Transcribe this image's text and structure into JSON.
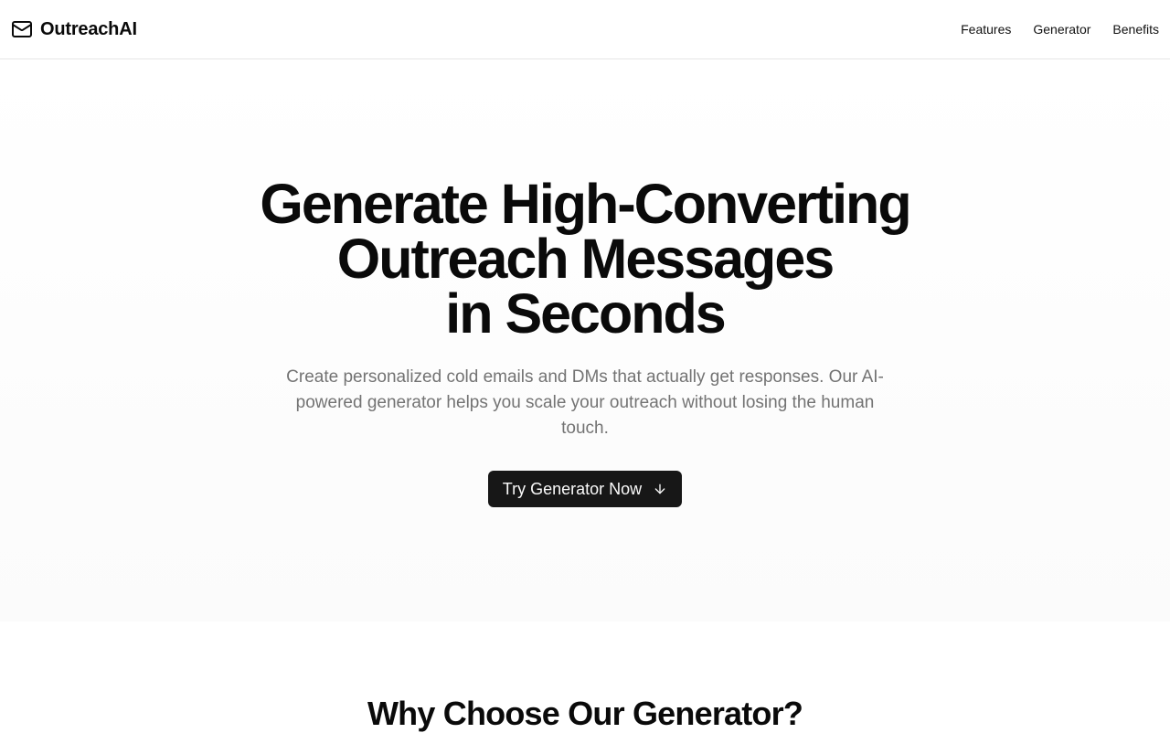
{
  "navbar": {
    "brand": "OutreachAI",
    "brand_icon": "mail-icon",
    "links": [
      {
        "label": "Features"
      },
      {
        "label": "Generator"
      },
      {
        "label": "Benefits"
      }
    ]
  },
  "hero": {
    "title_lines": [
      "Generate High-Converting",
      "Outreach Messages",
      "in Seconds"
    ],
    "subtitle": "Create personalized cold emails and DMs that actually get responses. Our AI-powered generator helps you scale your outreach without losing the human touch.",
    "cta_label": "Try Generator Now",
    "cta_icon": "arrow-down-icon"
  },
  "features": {
    "title": "Why Choose Our Generator?"
  },
  "colors": {
    "text": "#0a0a0a",
    "muted": "#737373",
    "button_bg": "#171717",
    "border": "#e5e5e5"
  }
}
